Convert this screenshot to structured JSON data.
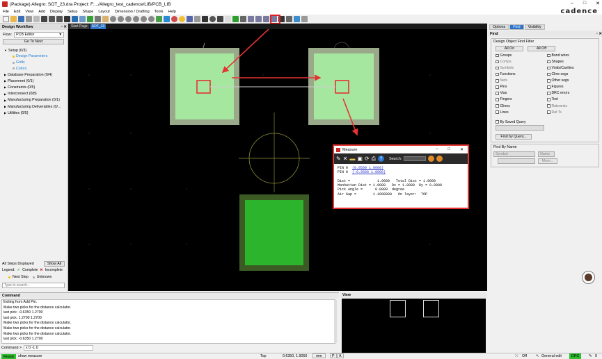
{
  "app": {
    "title": "(Package) Allegro: SOT_23.dra  Project: F:.../Allegro_test_cadence/LIB/PCB_LIB",
    "logo": "cadence",
    "window_buttons": [
      "–",
      "□",
      "✕"
    ]
  },
  "menu": [
    "File",
    "Edit",
    "View",
    "Add",
    "Display",
    "Setup",
    "Shape",
    "Layout",
    "Dimension / Drafting",
    "Tools",
    "Help"
  ],
  "left": {
    "header": "Design Workflow",
    "flow_label": "Flow:",
    "flow_value": "PCB Editor",
    "goto_next": "Go To Next",
    "workflow": [
      {
        "label": "Setup  (0/3)",
        "expanded": true,
        "children": [
          "Design Parameters",
          "Grids",
          "Colors"
        ]
      },
      {
        "label": "Database Preparation  (0/4)"
      },
      {
        "label": "Placement  (0/1)"
      },
      {
        "label": "Constraints  (0/5)"
      },
      {
        "label": "Interconnect  (0/8)"
      },
      {
        "label": "Manufacturing Preparation  (0/1)"
      },
      {
        "label": "Manufacturing Deliverables  (0/..."
      },
      {
        "label": "Utilities  (0/5)"
      }
    ],
    "all_steps": "All Steps Displayed",
    "show_all": "Show All",
    "legend_label": "Legend:",
    "legend_complete": "Complete",
    "legend_incomplete": "Incomplete",
    "legend_next": "Next Step",
    "legend_unknown": "Unknown",
    "search_placeholder": "Type to search..."
  },
  "canvas_tabs": [
    "Start Page",
    "SOT_23"
  ],
  "right": {
    "tabs": [
      "Options",
      "Find",
      "Visibility"
    ],
    "header": "Find",
    "group_title": "Design Object Find Filter",
    "all_on": "All On",
    "all_off": "All Off",
    "filters": [
      "Groups",
      "Bond wires",
      "Comps",
      "Shapes",
      "Symbols",
      "Voids/Cavities",
      "Functions",
      "Cline segs",
      "Nets",
      "Other segs",
      "Pins",
      "Figures",
      "Vias",
      "DRC errors",
      "Fingers",
      "Text",
      "Clines",
      "Ratsnests",
      "Lines",
      "Rat Ts"
    ],
    "by_saved_query": "By Saved Query",
    "find_by_query": "Find by Query...",
    "find_by_name": "Find By Name",
    "name_type": "Symbol",
    "name_mode": "Name",
    "more": "More..."
  },
  "measure": {
    "title": "Measure",
    "search_label": "Search:",
    "pin1_label": "PIN 0",
    "pin1_coord": "(0.9500 1.0000)",
    "pin2_label": "PIN 0",
    "pin2_coord": "(-0.9500 1.0000)",
    "line1": "Dist =             1.9000   Total Dist = 1.9000",
    "line2": "Manhattan Dist = 1.9000   Dx = 1.9000  Dy = 0.0000",
    "line3": "Pick Angle =      0.0000  degree",
    "line4": "Air Gap =        1.1000000   On layer:  TOP"
  },
  "command": {
    "header": "Command",
    "log": [
      "Exiting from Add Pin.",
      "Make two picks for the distance calculator.",
      "last pick:  -0.6350 1.2700",
      "last pick:  1.2700 1.2700",
      "Make two picks for the distance calculator.",
      "Make two picks for the distance calculator.",
      "Make two picks for the distance calculator.",
      "last pick:  -0.6350 1.2700",
      "last pick:  0.6350 1.2700"
    ],
    "prompt": "Command >",
    "input": "x 0 -1.0"
  },
  "view": {
    "header": "View"
  },
  "status": {
    "ready": "Ready",
    "mode": "show measure",
    "layer": "Top",
    "coords": "0.6350, 1.9050",
    "units": "mm",
    "p": "P",
    "a": "A",
    "off": "Off",
    "edit_mode": "General edit",
    "drc": "DRC",
    "count": "0"
  },
  "colors": {
    "pad_outer": "#9aa98a",
    "pad_inner": "#a6e7a0",
    "pad3_outer": "#3c5a23",
    "pad3_inner": "#2db42d",
    "arrow": "#e53333"
  }
}
